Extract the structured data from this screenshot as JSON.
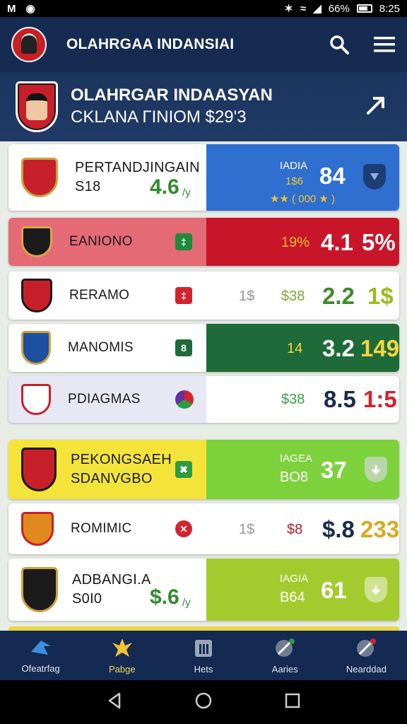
{
  "status_bar": {
    "left_icons": [
      "mail-icon",
      "app-icon"
    ],
    "battery": "66%",
    "time": "8:25"
  },
  "app_bar": {
    "title": "OLAHRGAA INDANSIAI"
  },
  "hero": {
    "title": "OLAHRGAR INDAASYAN",
    "subtitle": "CKLANA ΓINIOM  $29'3"
  },
  "rows": [
    {
      "name_line1": "PERTANDJINGAIN",
      "name_line2": "S18",
      "left_value": "4.6",
      "left_unit": "/y",
      "right_label1": "IADIA",
      "right_label2": "1$6",
      "score": "84",
      "stars_text": "★★ ( 000 ★ )",
      "colors": {
        "right_bg": "#2f6fd0",
        "accent": "#f2c230"
      }
    },
    {
      "name": "EANIONO",
      "badge": "‡",
      "pct": "19%",
      "score": "4.1",
      "extra": "5%",
      "colors": {
        "left_bg": "#e46a75",
        "right_bg": "#c8152a",
        "badge_bg": "#1f8a3a",
        "pct": "#f2c230"
      }
    },
    {
      "name": "RERAMO",
      "badge": "‡",
      "col1": "1$",
      "col2": "$38",
      "score": "2.2",
      "extra": "1$",
      "colors": {
        "badge_bg": "#d2232e",
        "col2": "#7da836",
        "score": "#3f8a2b",
        "extra": "#9bbb1e"
      }
    },
    {
      "name": "MANOMIS",
      "badge": "8",
      "col2": "14",
      "score": "3.2",
      "extra": "149",
      "colors": {
        "right_bg": "#1f6a39",
        "badge_bg": "#1f6a39",
        "col2": "#f5d640",
        "extra": "#f5d640"
      }
    },
    {
      "name": "PDIAGMAS",
      "col2": "$38",
      "score": "8.5",
      "extra": "1:5",
      "colors": {
        "bg": "#e8e8f4",
        "col2": "#3aa14a",
        "extra": "#d2232e"
      }
    },
    {
      "name_line1": "PEKONGSAEH",
      "name_line2": "SDANVGBO",
      "badge": "✖",
      "right_label1": "IAGEA",
      "right_label2": "BO8",
      "score": "37",
      "colors": {
        "left_bg": "#f4e43a",
        "right_bg": "#7dd13a",
        "badge_bg": "#2c9b42"
      }
    },
    {
      "name": "ROMIMIC",
      "badge": "✕",
      "col1": "1$",
      "col2": "$8",
      "score": "$.8",
      "extra": "233",
      "colors": {
        "badge_bg": "#d2232e",
        "col2": "#b32030",
        "score": "#182a4d",
        "extra": "#d7a91e"
      }
    },
    {
      "name_line1": "ADBANGI.A",
      "name_line2": "S0I0",
      "left_value": "$.6",
      "left_unit": "/y",
      "right_label1": "IAGIA",
      "right_label2": "B64",
      "score": "61",
      "colors": {
        "right_bg": "#a4cb2d",
        "left_value": "#2f8b2f"
      }
    }
  ],
  "bottom_nav": [
    {
      "label": "Ofeatrfag",
      "icon": "arrow-icon"
    },
    {
      "label": "Pabge",
      "icon": "eagle-icon",
      "active": true
    },
    {
      "label": "Hets",
      "icon": "building-icon"
    },
    {
      "label": "Aaries",
      "icon": "ball-icon"
    },
    {
      "label": "Nearddad",
      "icon": "badge-icon"
    }
  ]
}
